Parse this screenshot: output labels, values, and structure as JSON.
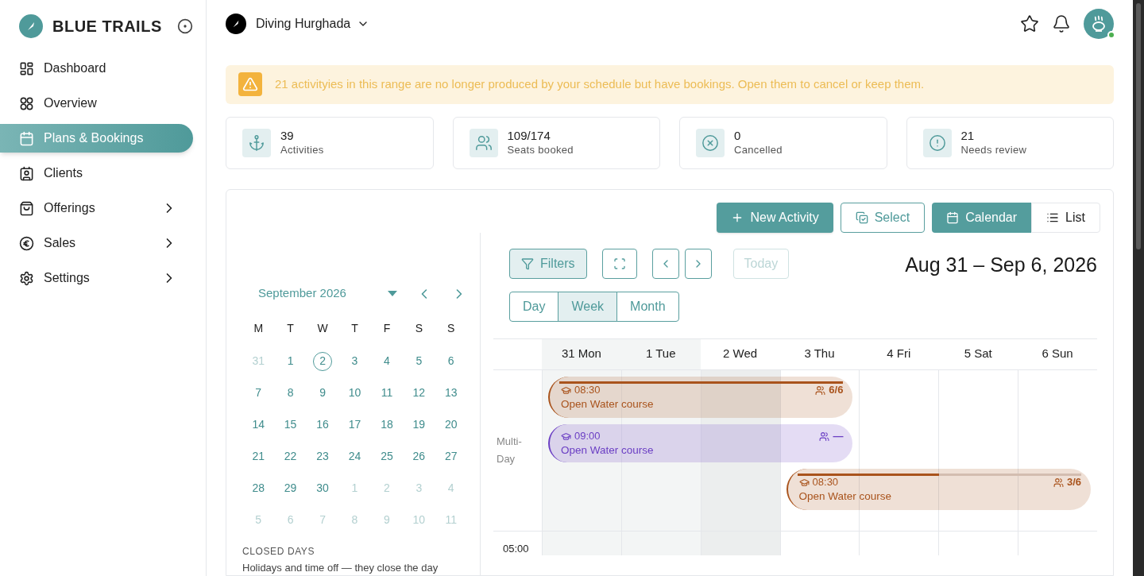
{
  "brand": {
    "name": "BLUE TRAILS"
  },
  "nav": [
    {
      "label": "Dashboard",
      "selected": false,
      "expandable": false
    },
    {
      "label": "Overview",
      "selected": false,
      "expandable": false
    },
    {
      "label": "Plans & Bookings",
      "selected": true,
      "expandable": false
    },
    {
      "label": "Clients",
      "selected": false,
      "expandable": false
    },
    {
      "label": "Offerings",
      "selected": false,
      "expandable": true
    },
    {
      "label": "Sales",
      "selected": false,
      "expandable": true
    },
    {
      "label": "Settings",
      "selected": false,
      "expandable": true
    }
  ],
  "workspace": {
    "name": "Diving Hurghada"
  },
  "user": {
    "online": true
  },
  "alert": {
    "text": "21 activityies in this range are no longer produced by your schedule but have bookings. Open them to cancel or keep them."
  },
  "stats": [
    {
      "value": "39",
      "label": "Activities"
    },
    {
      "value": "109/174",
      "label": "Seats booked"
    },
    {
      "value": "0",
      "label": "Cancelled"
    },
    {
      "value": "21",
      "label": "Needs review"
    }
  ],
  "actions": {
    "new": "New Activity",
    "select": "Select",
    "views": [
      {
        "label": "Calendar",
        "selected": true
      },
      {
        "label": "List",
        "selected": false
      }
    ]
  },
  "mini_calendar": {
    "month": "September 2026",
    "weekdays": [
      "M",
      "T",
      "W",
      "T",
      "F",
      "S",
      "S"
    ],
    "weeks": [
      [
        {
          "day": "31",
          "outside": true,
          "selected": false
        },
        {
          "day": "1",
          "outside": false,
          "selected": false
        },
        {
          "day": "2",
          "outside": false,
          "selected": true
        },
        {
          "day": "3",
          "outside": false,
          "selected": false
        },
        {
          "day": "4",
          "outside": false,
          "selected": false
        },
        {
          "day": "5",
          "outside": false,
          "selected": false
        },
        {
          "day": "6",
          "outside": false,
          "selected": false
        }
      ],
      [
        {
          "day": "7",
          "outside": false,
          "selected": false
        },
        {
          "day": "8",
          "outside": false,
          "selected": false
        },
        {
          "day": "9",
          "outside": false,
          "selected": false
        },
        {
          "day": "10",
          "outside": false,
          "selected": false
        },
        {
          "day": "11",
          "outside": false,
          "selected": false
        },
        {
          "day": "12",
          "outside": false,
          "selected": false
        },
        {
          "day": "13",
          "outside": false,
          "selected": false
        }
      ],
      [
        {
          "day": "14",
          "outside": false,
          "selected": false
        },
        {
          "day": "15",
          "outside": false,
          "selected": false
        },
        {
          "day": "16",
          "outside": false,
          "selected": false
        },
        {
          "day": "17",
          "outside": false,
          "selected": false
        },
        {
          "day": "18",
          "outside": false,
          "selected": false
        },
        {
          "day": "19",
          "outside": false,
          "selected": false
        },
        {
          "day": "20",
          "outside": false,
          "selected": false
        }
      ],
      [
        {
          "day": "21",
          "outside": false,
          "selected": false
        },
        {
          "day": "22",
          "outside": false,
          "selected": false
        },
        {
          "day": "23",
          "outside": false,
          "selected": false
        },
        {
          "day": "24",
          "outside": false,
          "selected": false
        },
        {
          "day": "25",
          "outside": false,
          "selected": false
        },
        {
          "day": "26",
          "outside": false,
          "selected": false
        },
        {
          "day": "27",
          "outside": false,
          "selected": false
        }
      ],
      [
        {
          "day": "28",
          "outside": false,
          "selected": false
        },
        {
          "day": "29",
          "outside": false,
          "selected": false
        },
        {
          "day": "30",
          "outside": false,
          "selected": false
        },
        {
          "day": "1",
          "outside": true,
          "selected": false
        },
        {
          "day": "2",
          "outside": true,
          "selected": false
        },
        {
          "day": "3",
          "outside": true,
          "selected": false
        },
        {
          "day": "4",
          "outside": true,
          "selected": false
        }
      ],
      [
        {
          "day": "5",
          "outside": true,
          "selected": false
        },
        {
          "day": "6",
          "outside": true,
          "selected": false
        },
        {
          "day": "7",
          "outside": true,
          "selected": false
        },
        {
          "day": "8",
          "outside": true,
          "selected": false
        },
        {
          "day": "9",
          "outside": true,
          "selected": false
        },
        {
          "day": "10",
          "outside": true,
          "selected": false
        },
        {
          "day": "11",
          "outside": true,
          "selected": false
        }
      ]
    ],
    "closed_days": {
      "heading": "CLOSED DAYS",
      "text": "Holidays and time off — they close the day"
    }
  },
  "week_view": {
    "filters": "Filters",
    "today": {
      "label": "Today",
      "disabled": true
    },
    "range_title": "Aug 31 – Sep 6, 2026",
    "ranges": [
      {
        "label": "Day",
        "selected": false
      },
      {
        "label": "Week",
        "selected": true
      },
      {
        "label": "Month",
        "selected": false
      }
    ],
    "days": [
      {
        "label": "31 Mon",
        "past": true,
        "today": false
      },
      {
        "label": "1 Tue",
        "past": true,
        "today": false
      },
      {
        "label": "2 Wed",
        "past": false,
        "today": true
      },
      {
        "label": "3 Thu",
        "past": false,
        "today": false
      },
      {
        "label": "4 Fri",
        "past": false,
        "today": false
      },
      {
        "label": "5 Sat",
        "past": false,
        "today": false
      },
      {
        "label": "6 Sun",
        "past": false,
        "today": false
      }
    ],
    "multi_day_label": "Multi-Day",
    "events": [
      {
        "time": "08:30",
        "title": "Open Water course",
        "booked": "6/6",
        "color": "#a9531c",
        "level": 1,
        "on_days": [
          true,
          true,
          true,
          true,
          false,
          false,
          false
        ]
      },
      {
        "time": "09:00",
        "title": "Open Water course",
        "booked": "—",
        "color": "#6b3fc4",
        "on_days": [
          true,
          true,
          true,
          true,
          false,
          false,
          false
        ]
      },
      {
        "time": "08:30",
        "title": "Open Water course",
        "booked": "3/6",
        "color": "#a9531c",
        "level": 0.5,
        "on_days": [
          false,
          false,
          false,
          true,
          true,
          true,
          true
        ]
      }
    ],
    "first_hour": "05:00"
  }
}
